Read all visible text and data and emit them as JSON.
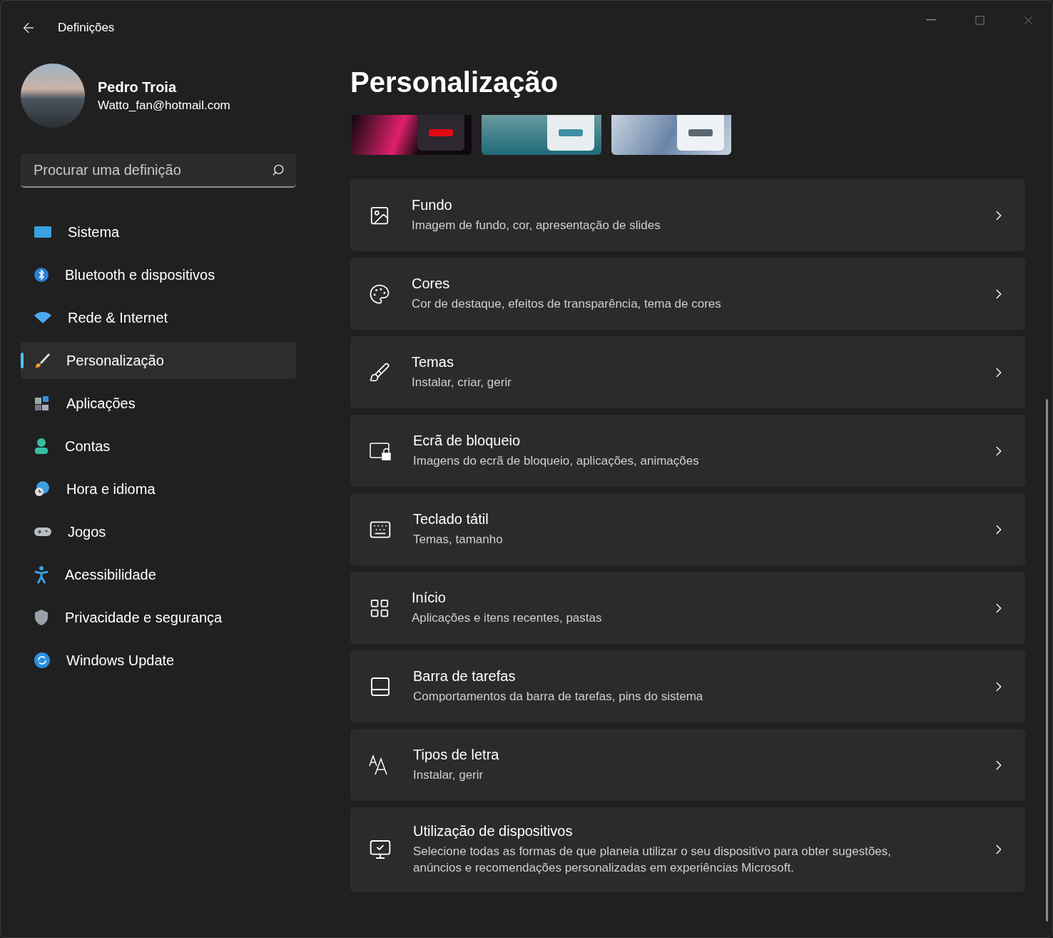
{
  "window": {
    "title": "Definições"
  },
  "profile": {
    "name": "Pedro Troia",
    "email": "Watto_fan@hotmail.com"
  },
  "search": {
    "placeholder": "Procurar uma definição"
  },
  "sidebar": {
    "items": [
      {
        "label": "Sistema",
        "selected": false
      },
      {
        "label": "Bluetooth e dispositivos",
        "selected": false
      },
      {
        "label": "Rede & Internet",
        "selected": false
      },
      {
        "label": "Personalização",
        "selected": true
      },
      {
        "label": "Aplicações",
        "selected": false
      },
      {
        "label": "Contas",
        "selected": false
      },
      {
        "label": "Hora e idioma",
        "selected": false
      },
      {
        "label": "Jogos",
        "selected": false
      },
      {
        "label": "Acessibilidade",
        "selected": false
      },
      {
        "label": "Privacidade e segurança",
        "selected": false
      },
      {
        "label": "Windows Update",
        "selected": false
      }
    ]
  },
  "page": {
    "title": "Personalização"
  },
  "themes": [
    {
      "color": "#e00a14"
    },
    {
      "color": "#3f8ea3"
    },
    {
      "color": "#5b6770"
    }
  ],
  "cards": [
    {
      "title": "Fundo",
      "subtitle": "Imagem de fundo, cor, apresentação de slides"
    },
    {
      "title": "Cores",
      "subtitle": "Cor de destaque, efeitos de transparência, tema de cores"
    },
    {
      "title": "Temas",
      "subtitle": "Instalar, criar, gerir"
    },
    {
      "title": "Ecrã de bloqueio",
      "subtitle": "Imagens do ecrã de bloqueio, aplicações, animações"
    },
    {
      "title": "Teclado tátil",
      "subtitle": "Temas, tamanho"
    },
    {
      "title": "Início",
      "subtitle": "Aplicações e itens recentes, pastas"
    },
    {
      "title": "Barra de tarefas",
      "subtitle": "Comportamentos da barra de tarefas, pins do sistema"
    },
    {
      "title": "Tipos de letra",
      "subtitle": "Instalar, gerir"
    },
    {
      "title": "Utilização de dispositivos",
      "subtitle": "Selecione todas as formas de que planeia utilizar o seu dispositivo para obter sugestões, anúncios e recomendações personalizadas em experiências Microsoft."
    }
  ]
}
